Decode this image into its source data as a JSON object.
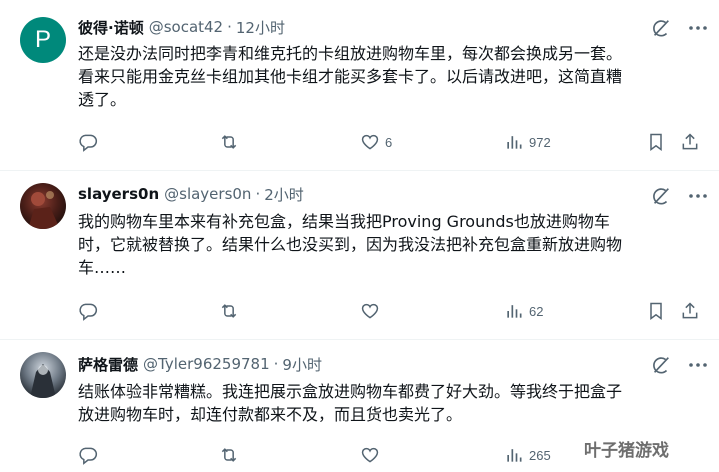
{
  "tweets": [
    {
      "avatar_letter": "P",
      "avatar_color": "#00897b",
      "name": "彼得·诺顿",
      "handle": "@socat42",
      "time": "12小时",
      "lines": [
        "还是没办法同时把李青和维克托的卡组放进购物车里，每次都会换成另一套。",
        "看来只能用金克丝卡组加其他卡组才能买多套卡了。以后请改进吧，这简直糟",
        "透了。"
      ],
      "replies": "",
      "retweets": "",
      "likes": "6",
      "views": "972"
    },
    {
      "avatar_letter": "",
      "name": "slayers0n",
      "handle": "@slayers0n",
      "time": "2小时",
      "lines": [
        "我的购物车里本来有补充包盒，结果当我把Proving Grounds也放进购物车",
        "时，它就被替换了。结果什么也没买到，因为我没法把补充包盒重新放进购物",
        "车……"
      ],
      "replies": "",
      "retweets": "",
      "likes": "",
      "views": "62"
    },
    {
      "avatar_letter": "",
      "name": "萨格雷德",
      "handle": "@Tyler96259781",
      "time": "9小时",
      "lines": [
        "结账体验非常糟糕。我连把展示盒放进购物车都费了好大劲。等我终于把盒子",
        "放进购物车时，却连付款都来不及，而且货也卖光了。"
      ],
      "replies": "",
      "retweets": "",
      "likes": "",
      "views": "265"
    }
  ],
  "icons": {
    "reply": "reply-icon",
    "retweet": "retweet-icon",
    "like": "heart-icon",
    "views": "views-icon",
    "bookmark": "bookmark-icon",
    "share": "share-icon",
    "grok": "grok-icon",
    "more": "more-icon"
  },
  "watermark": "叶子猪游戏"
}
